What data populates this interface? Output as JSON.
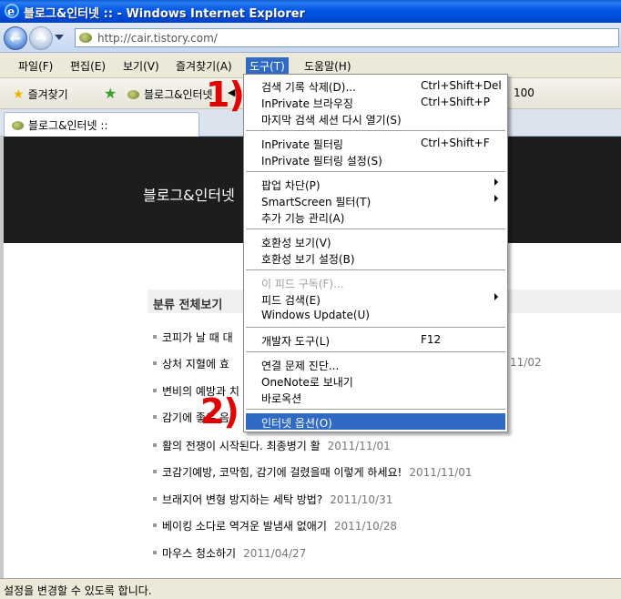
{
  "window": {
    "title": "블로그&인터넷 :: - Windows Internet Explorer"
  },
  "address": {
    "url": "http://cair.tistory.com/"
  },
  "menubar": {
    "items": [
      "파일(F)",
      "편집(E)",
      "보기(V)",
      "즐겨찾기(A)",
      "도구(T)",
      "도움말(H)"
    ]
  },
  "favbar": {
    "favorites_label": "즐겨찾기",
    "link_label": "블로그&인터넷",
    "zoom_label": "100"
  },
  "tab": {
    "label": "블로그&인터넷 ::"
  },
  "blog": {
    "title": "블로그&인터넷",
    "category_title": "분류 전체보기",
    "posts": [
      {
        "title": "코피가 날 때 대",
        "date": ""
      },
      {
        "title": "상처 지혈에 효",
        "date": "11/02"
      },
      {
        "title": "변비의 예방과 치",
        "date": ""
      },
      {
        "title": "감기에 좋은 음",
        "date": ""
      },
      {
        "title": "활의 전쟁이 시작된다. 최종병기 활",
        "date": "2011/11/01"
      },
      {
        "title": "코감기예방, 코막힘, 감기에 걸렸을때 이렇게 하세요!",
        "date": "2011/11/01"
      },
      {
        "title": "브래지어 변형 방지하는 세탁 방법?",
        "date": "2011/10/31"
      },
      {
        "title": "베이킹 소다로 역겨운 발냄새 없애기",
        "date": "2011/10/28"
      },
      {
        "title": "마우스 청소하기",
        "date": "2011/04/27"
      }
    ]
  },
  "tools_menu": {
    "items": [
      {
        "label": "검색 기록 삭제(D)...",
        "shortcut": "Ctrl+Shift+Del"
      },
      {
        "label": "InPrivate 브라우징",
        "shortcut": "Ctrl+Shift+P"
      },
      {
        "label": "마지막 검색 세션 다시 열기(S)",
        "shortcut": ""
      },
      {
        "label": "InPrivate 필터링",
        "shortcut": "Ctrl+Shift+F"
      },
      {
        "label": "InPrivate 필터링 설정(S)",
        "shortcut": ""
      },
      {
        "label": "팝업 차단(P)",
        "shortcut": ""
      },
      {
        "label": "SmartScreen 필터(T)",
        "shortcut": ""
      },
      {
        "label": "추가 기능 관리(A)",
        "shortcut": ""
      },
      {
        "label": "호환성 보기(V)",
        "shortcut": ""
      },
      {
        "label": "호환성 보기 설정(B)",
        "shortcut": ""
      },
      {
        "label": "이 피드 구독(F)...",
        "shortcut": ""
      },
      {
        "label": "피드 검색(E)",
        "shortcut": ""
      },
      {
        "label": "Windows Update(U)",
        "shortcut": ""
      },
      {
        "label": "개발자 도구(L)",
        "shortcut": "F12"
      },
      {
        "label": "연결 문제 진단...",
        "shortcut": ""
      },
      {
        "label": "OneNote로 보내기",
        "shortcut": ""
      },
      {
        "label": "바로옥션",
        "shortcut": ""
      },
      {
        "label": "인터넷 옵션(O)",
        "shortcut": ""
      }
    ]
  },
  "annotations": {
    "step1": "1)",
    "step2": "2)"
  },
  "statusbar": {
    "text": "설정을 변경할 수 있도록 합니다."
  },
  "colors": {
    "title_bar": "#0054e3",
    "highlight": "#316ac5",
    "annotation": "#e00000",
    "blog_header": "#1d1d1d"
  }
}
